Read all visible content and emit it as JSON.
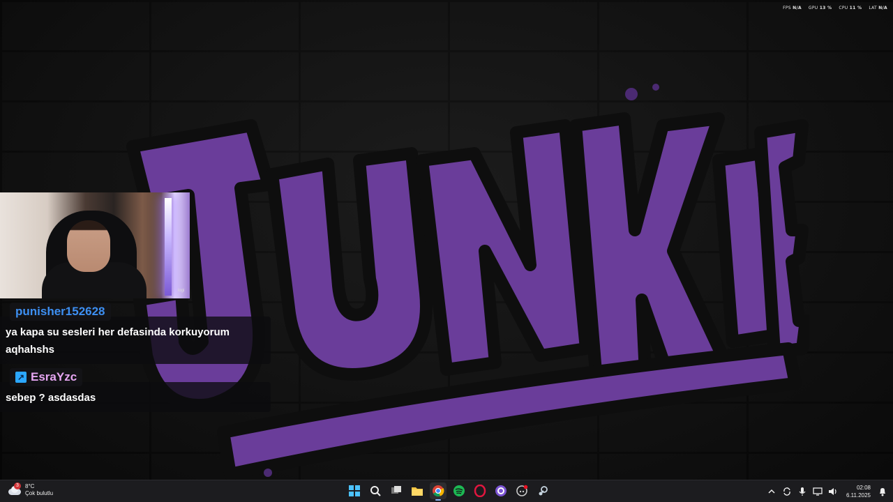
{
  "overlay_stats": [
    {
      "label": "FPS",
      "value": "N/A"
    },
    {
      "label": "GPU",
      "value": "13 %"
    },
    {
      "label": "CPU",
      "value": "11 %"
    },
    {
      "label": "LAT",
      "value": "N/A"
    }
  ],
  "webcam": {
    "brand": "logi"
  },
  "logo": {
    "text": "JUNKIE",
    "fill": "#6a3d9a",
    "stroke": "#0e0e0e",
    "outline": "#4b2a72"
  },
  "chat": [
    {
      "user": "punisher152628",
      "user_color": "#3d8ff2",
      "badge": false,
      "lines": [
        "ya kapa su sesleri her defasinda korkuyorum",
        "aqhahshs"
      ]
    },
    {
      "user": "EsraYzc",
      "user_color": "#e6a6f2",
      "badge": true,
      "lines": [
        "sebep ? asdasdas"
      ]
    }
  ],
  "taskbar": {
    "weather": {
      "temp": "8°C",
      "condition": "Çok bulutlu",
      "notifications": "3"
    },
    "apps": [
      "windows-start",
      "search",
      "task-view",
      "file-explorer",
      "chrome",
      "spotify",
      "opera-gx",
      "obs",
      "discord",
      "steam"
    ],
    "clock": {
      "time": "02:08",
      "date": "6.11.2025"
    }
  }
}
